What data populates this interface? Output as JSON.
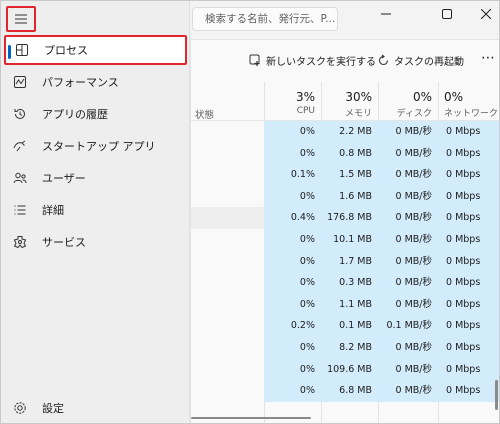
{
  "search": {
    "placeholder": "検索する名前、発行元、P..."
  },
  "nav": {
    "items": [
      {
        "label": "プロセス",
        "icon": "processes-icon",
        "selected": true
      },
      {
        "label": "パフォーマンス",
        "icon": "performance-icon"
      },
      {
        "label": "アプリの履歴",
        "icon": "history-icon"
      },
      {
        "label": "スタートアップ アプリ",
        "icon": "startup-icon"
      },
      {
        "label": "ユーザー",
        "icon": "users-icon"
      },
      {
        "label": "詳細",
        "icon": "details-icon"
      },
      {
        "label": "サービス",
        "icon": "services-icon"
      }
    ],
    "settings_label": "設定"
  },
  "toolbar": {
    "new_task_label": "新しいタスクを実行する",
    "restart_label": "タスクの再起動"
  },
  "table": {
    "status_header": "状態",
    "cpu": {
      "percent": "3%",
      "label": "CPU"
    },
    "memory": {
      "percent": "30%",
      "label": "メモリ"
    },
    "disk": {
      "percent": "0%",
      "label": "ディスク"
    },
    "network": {
      "percent": "0%",
      "label": "ネットワーク"
    },
    "rows": [
      {
        "cpu": "0%",
        "mem": "2.2 MB",
        "disk": "0 MB/秒",
        "net": "0 Mbps"
      },
      {
        "cpu": "0%",
        "mem": "0.8 MB",
        "disk": "0 MB/秒",
        "net": "0 Mbps"
      },
      {
        "cpu": "0.1%",
        "mem": "1.5 MB",
        "disk": "0 MB/秒",
        "net": "0 Mbps"
      },
      {
        "cpu": "0%",
        "mem": "1.6 MB",
        "disk": "0 MB/秒",
        "net": "0 Mbps"
      },
      {
        "cpu": "0.4%",
        "mem": "176.8 MB",
        "disk": "0 MB/秒",
        "net": "0 Mbps",
        "highlight": true
      },
      {
        "cpu": "0%",
        "mem": "10.1 MB",
        "disk": "0 MB/秒",
        "net": "0 Mbps"
      },
      {
        "cpu": "0%",
        "mem": "1.7 MB",
        "disk": "0 MB/秒",
        "net": "0 Mbps"
      },
      {
        "cpu": "0%",
        "mem": "0.3 MB",
        "disk": "0 MB/秒",
        "net": "0 Mbps"
      },
      {
        "cpu": "0%",
        "mem": "1.1 MB",
        "disk": "0 MB/秒",
        "net": "0 Mbps"
      },
      {
        "cpu": "0.2%",
        "mem": "0.1 MB",
        "disk": "0.1 MB/秒",
        "net": "0 Mbps"
      },
      {
        "cpu": "0%",
        "mem": "8.2 MB",
        "disk": "0 MB/秒",
        "net": "0 Mbps"
      },
      {
        "cpu": "0%",
        "mem": "109.6 MB",
        "disk": "0 MB/秒",
        "net": "0 Mbps"
      },
      {
        "cpu": "0%",
        "mem": "6.8 MB",
        "disk": "0 MB/秒",
        "net": "0 Mbps"
      }
    ]
  },
  "colors": {
    "accent": "#0067c0",
    "highlight_box": "#e0262f",
    "heat": "#d3ecfc"
  }
}
